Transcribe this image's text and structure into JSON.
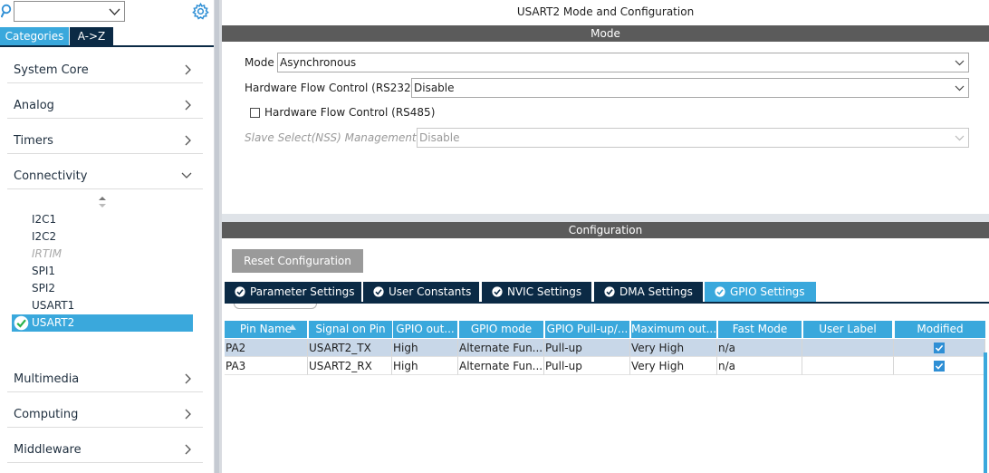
{
  "left": {
    "search": {
      "value": ""
    },
    "tabs": [
      "Categories",
      "A->Z"
    ],
    "categories": [
      {
        "label": "System Core"
      },
      {
        "label": "Analog"
      },
      {
        "label": "Timers"
      },
      {
        "label": "Connectivity"
      },
      {
        "label": "Multimedia"
      },
      {
        "label": "Computing"
      },
      {
        "label": "Middleware"
      }
    ],
    "peripherals": [
      "I2C1",
      "I2C2",
      "IRTIM",
      "SPI1",
      "SPI2",
      "USART1",
      "USART2"
    ]
  },
  "right": {
    "title": "USART2 Mode and Configuration",
    "mode_section": "Mode",
    "fields": {
      "mode_label": "Mode",
      "mode_value": "Asynchronous",
      "hfc232_label": "Hardware Flow Control (RS232)",
      "hfc232_value": "Disable",
      "hfc485_label": "Hardware Flow Control (RS485)",
      "nss_label": "Slave Select(NSS) Management",
      "nss_value": "Disable"
    },
    "config_section": "Configuration",
    "reset_button": "Reset Configuration",
    "tabs": [
      "Parameter Settings",
      "User Constants",
      "NVIC Settings",
      "DMA Settings",
      "GPIO Settings"
    ],
    "active_tab": "GPIO Settings",
    "table": {
      "headers": [
        "Pin Name",
        "Signal on Pin",
        "GPIO out...",
        "GPIO mode",
        "GPIO Pull-up/...",
        "Maximum out...",
        "Fast Mode",
        "User Label",
        "Modified"
      ],
      "rows": [
        [
          "PA2",
          "USART2_TX",
          "High",
          "Alternate Fun...",
          "Pull-up",
          "Very High",
          "n/a",
          "",
          ""
        ],
        [
          "PA3",
          "USART2_RX",
          "High",
          "Alternate Fun...",
          "Pull-up",
          "Very High",
          "n/a",
          "",
          ""
        ]
      ]
    }
  },
  "colors": {
    "accent": "#3aa8dc",
    "navy": "#0b2a45",
    "bar": "#5b5b5b"
  },
  "icons": [
    "search-icon",
    "gear-icon",
    "chevron-right-icon",
    "chevron-down-icon",
    "check-circle-icon",
    "sort-arrow-icon",
    "checkbox-checked-icon"
  ]
}
